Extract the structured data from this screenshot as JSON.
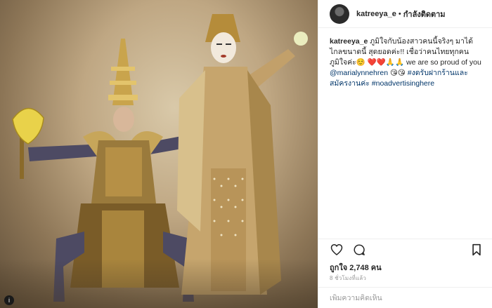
{
  "post": {
    "username": "katreeya_e",
    "separator": "•",
    "follow_status": "กำลังติดตาม",
    "caption": {
      "username": "katreeya_e",
      "text_before": "ภูมิใจกับน้องสาวคนนี้จริงๆ มาได้ไกลขนาดนี้ สุดยอดค่ะ!! เชื่อว่าคนไทยทุกคนภูมิใจค่ะ☺️ ❤️❤️🙏🙏 we are so proud of you ",
      "mention": "@marialynnehren",
      "emoji": " 😘😘 ",
      "hashtag1": "#งดรับฝากร้านและสมัครงานค่ะ",
      "space": " ",
      "hashtag2": "#noadvertisinghere"
    },
    "likes_text": "ถูกใจ 2,748 คน",
    "time_ago": "8 ชั่วโมงที่แล้ว",
    "comment_placeholder": "เพิ่มความคิดเห็น",
    "photo_credit": "i"
  },
  "icons": {
    "like": "heart-icon",
    "comment": "comment-bubble-icon",
    "save": "bookmark-icon"
  }
}
